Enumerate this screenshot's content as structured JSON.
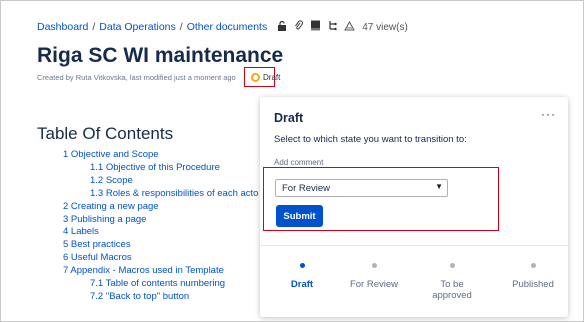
{
  "breadcrumb": {
    "items": [
      "Dashboard",
      "Data Operations",
      "Other documents"
    ],
    "views": "47 view(s)"
  },
  "page": {
    "title": "Riga SC WI maintenance",
    "byline": "Created by Ruta Vitkovska, last modified just a moment ago",
    "status": "Draft"
  },
  "toc": {
    "title": "Table Of Contents",
    "items": [
      {
        "text": "1 Objective and Scope",
        "level": 1
      },
      {
        "text": "1.1 Objective of this Procedure",
        "level": 2
      },
      {
        "text": "1.2 Scope",
        "level": 2
      },
      {
        "text": "1.3 Roles & responsibilities of each acto",
        "level": 2
      },
      {
        "text": "2 Creating a new page",
        "level": 1
      },
      {
        "text": "3 Publishing a page",
        "level": 1
      },
      {
        "text": "4 Labels",
        "level": 1
      },
      {
        "text": "5 Best practices",
        "level": 1
      },
      {
        "text": "6 Useful Macros",
        "level": 1
      },
      {
        "text": "7 Appendix - Macros used in Template",
        "level": 1
      },
      {
        "text": "7.1 Table of contents numbering",
        "level": 2
      },
      {
        "text": "7.2 \"Back to top\" button",
        "level": 2
      }
    ]
  },
  "panel": {
    "title": "Draft",
    "more": "···",
    "prompt": "Select to which state you want to transition to:",
    "add_comment": "Add comment",
    "select_value": "For Review",
    "submit_label": "Submit",
    "steps": [
      {
        "label": "Draft",
        "active": true
      },
      {
        "label": "For Review",
        "active": false
      },
      {
        "label": "To be approved",
        "active": false
      },
      {
        "label": "Published",
        "active": false
      }
    ]
  },
  "colors": {
    "accent": "#0052cc",
    "highlight": "#d0021b",
    "status_ring": "#f5a623"
  }
}
